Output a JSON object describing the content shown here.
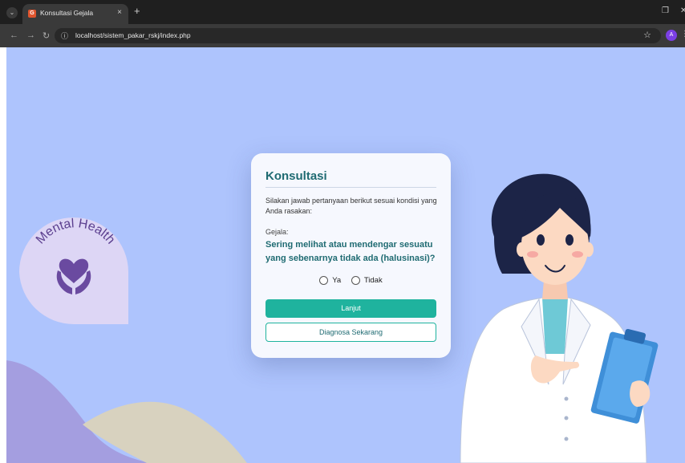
{
  "browser": {
    "tab_title": "Konsultasi Gejala",
    "tab_favicon": "G",
    "tab_close": "×",
    "new_tab": "+",
    "url": "localhost/sistem_pakar_rskj/index.php",
    "profile_initial": "A"
  },
  "logo": {
    "text": "Mental Health"
  },
  "card": {
    "title": "Konsultasi",
    "intro": "Silakan jawab pertanyaan berikut sesuai kondisi yang Anda rasakan:",
    "symptom_label": "Gejala:",
    "question": "Sering melihat atau mendengar sesuatu yang sebenarnya tidak ada (halusinasi)?",
    "option_yes": "Ya",
    "option_no": "Tidak",
    "next_button": "Lanjut",
    "diagnose_button": "Diagnosa Sekarang"
  },
  "colors": {
    "page_background": "#aec4fd",
    "accent": "#1fb39e",
    "title_color": "#1f6b72"
  }
}
